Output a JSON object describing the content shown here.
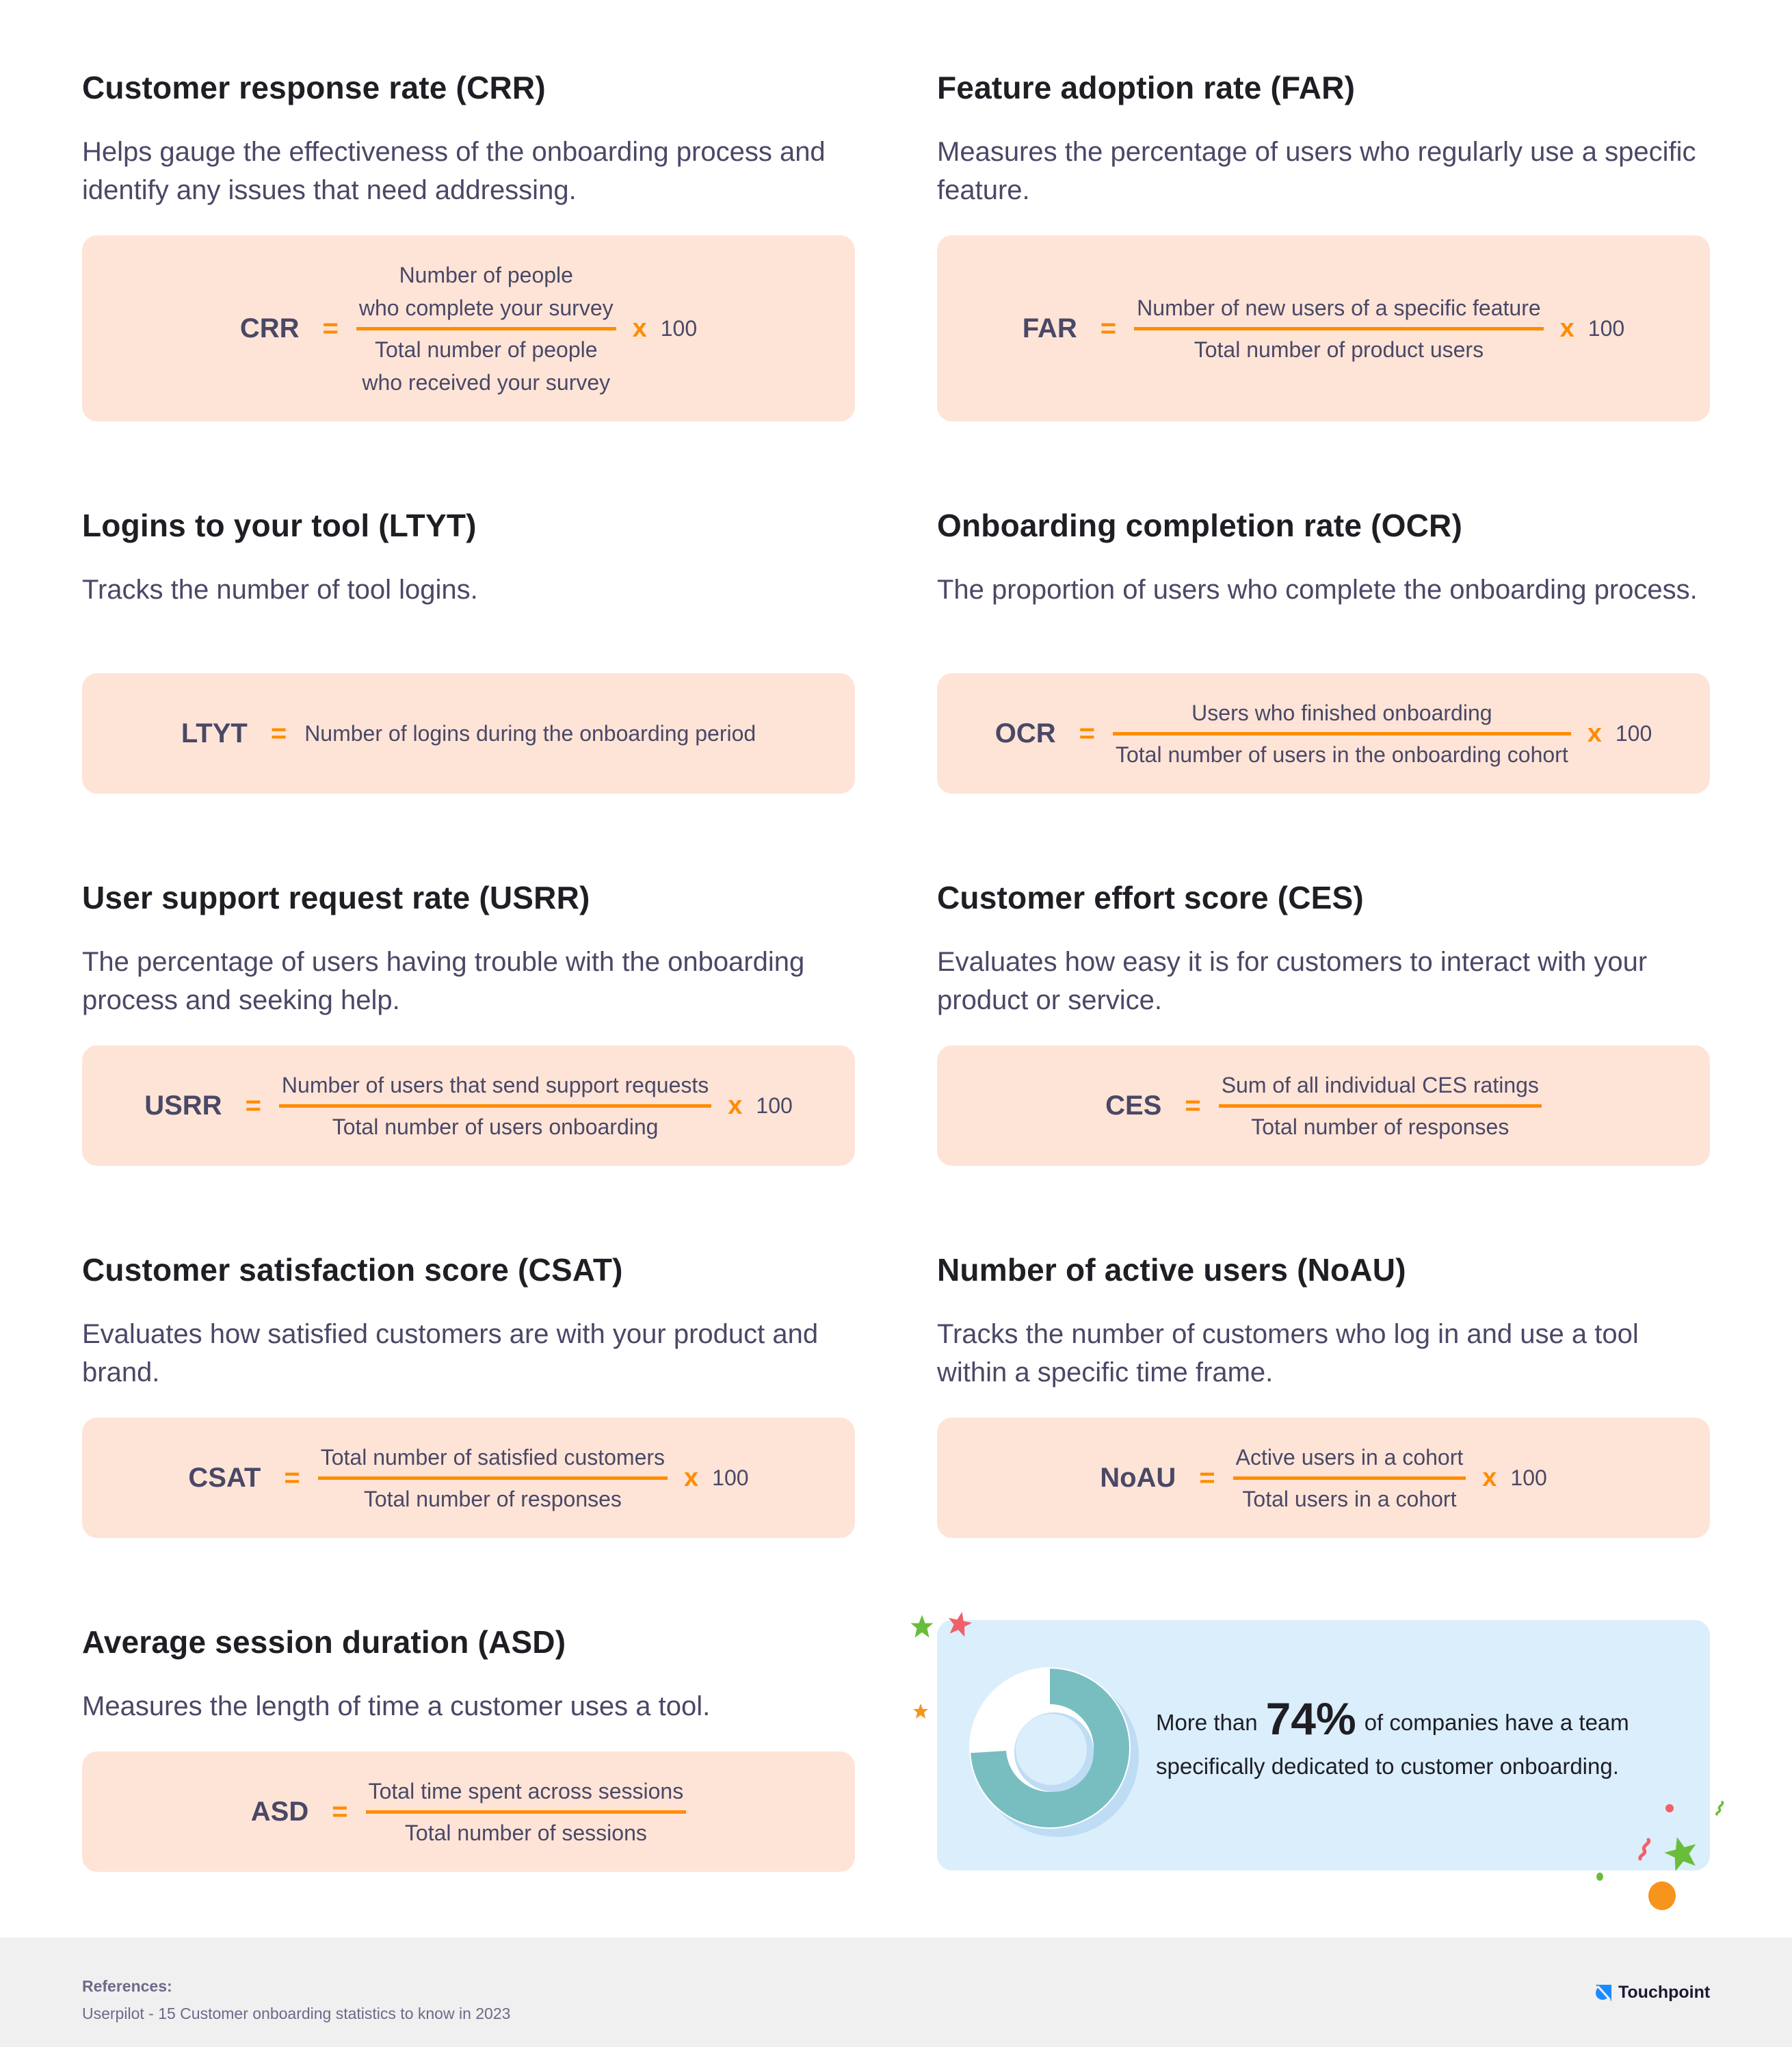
{
  "metrics": [
    {
      "title": "Customer response rate (CRR)",
      "description": "Helps gauge the effectiveness of the onboarding process and identify any issues that need addressing.",
      "formula": {
        "abbr": "CRR",
        "equals": "=",
        "numerator_lines": [
          "Number of people",
          "who complete your survey"
        ],
        "denominator_lines": [
          "Total number of people",
          "who received your survey"
        ],
        "times": "x",
        "multiplier": "100"
      }
    },
    {
      "title": "Feature adoption rate (FAR)",
      "description": "Measures the percentage of users who regularly use a specific feature.",
      "formula": {
        "abbr": "FAR",
        "equals": "=",
        "numerator": "Number of new users of a specific feature",
        "denominator": "Total number of product users",
        "times": "x",
        "multiplier": "100"
      }
    },
    {
      "title": "Logins to your tool (LTYT)",
      "description": "Tracks the number of tool logins.",
      "formula": {
        "abbr": "LTYT",
        "equals": "=",
        "expression": "Number of logins during the onboarding period"
      }
    },
    {
      "title": "Onboarding completion rate (OCR)",
      "description": "The proportion of users who complete the onboarding process.",
      "formula": {
        "abbr": "OCR",
        "equals": "=",
        "numerator": "Users who finished onboarding",
        "denominator": "Total number of users in the onboarding cohort",
        "times": "x",
        "multiplier": "100"
      }
    },
    {
      "title": "User support request rate (USRR)",
      "description": "The percentage of users having trouble with the onboarding process and seeking help.",
      "formula": {
        "abbr": "USRR",
        "equals": "=",
        "numerator": "Number of users that send support requests",
        "denominator": "Total number of users onboarding",
        "times": "x",
        "multiplier": "100"
      }
    },
    {
      "title": "Customer effort score (CES)",
      "description": "Evaluates how easy it is for customers to interact with your product or service.",
      "formula": {
        "abbr": "CES",
        "equals": "=",
        "numerator": "Sum of all individual CES ratings",
        "denominator": "Total number of responses"
      }
    },
    {
      "title": "Customer satisfaction score (CSAT)",
      "description": "Evaluates how satisfied customers are with your product and brand.",
      "formula": {
        "abbr": "CSAT",
        "equals": "=",
        "numerator": "Total number of satisfied customers",
        "denominator": "Total number of responses",
        "times": "x",
        "multiplier": "100"
      }
    },
    {
      "title": "Number of active users (NoAU)",
      "description": "Tracks the number of customers who log in and use a tool within a specific time frame.",
      "formula": {
        "abbr": "NoAU",
        "equals": "=",
        "numerator": "Active users in a cohort",
        "denominator": "Total users in a cohort",
        "times": "x",
        "multiplier": "100"
      }
    },
    {
      "title": "Average session duration (ASD)",
      "description": "Measures the length of time a customer uses a tool.",
      "formula": {
        "abbr": "ASD",
        "equals": "=",
        "numerator": "Total time spent across sessions",
        "denominator": "Total number of sessions"
      }
    }
  ],
  "stat_card": {
    "prefix": "More than",
    "value": "74%",
    "suffix_line1": "of companies have a team",
    "suffix_line2": "specifically dedicated to customer onboarding.",
    "donut_fraction": 0.74,
    "colors": {
      "fill": "#78bec0",
      "track": "#ffffff",
      "shadow": "#bedcf4",
      "background": "#dbeefc"
    }
  },
  "footer": {
    "references_label": "References:",
    "reference": "Userpilot - 15 Customer onboarding statistics to know in 2023",
    "brand": "Touchpoint",
    "brand_icon": "touchpoint-logo-icon"
  },
  "colors": {
    "accent": "#ff8c00",
    "formula_bg": "#fee4d7",
    "title": "#1e1e24",
    "body": "#4a4866"
  }
}
